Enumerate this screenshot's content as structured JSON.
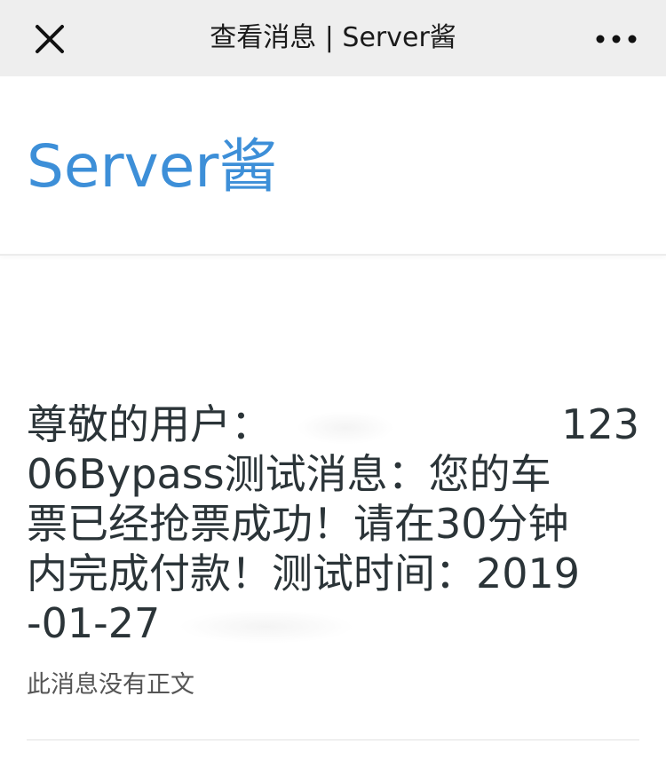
{
  "header": {
    "title": "查看消息 | Server酱"
  },
  "brand": {
    "name": "Server酱",
    "color": "#3d8fd8"
  },
  "message": {
    "line1_label": "尊敬的用户：",
    "line1_tail": "123",
    "line2": "06Bypass测试消息：您的车",
    "line3": "票已经抢票成功！请在30分钟",
    "line4": "内完成付款！测试时间：2019",
    "line5": "-01-27"
  },
  "note": {
    "text": "此消息没有正文"
  }
}
